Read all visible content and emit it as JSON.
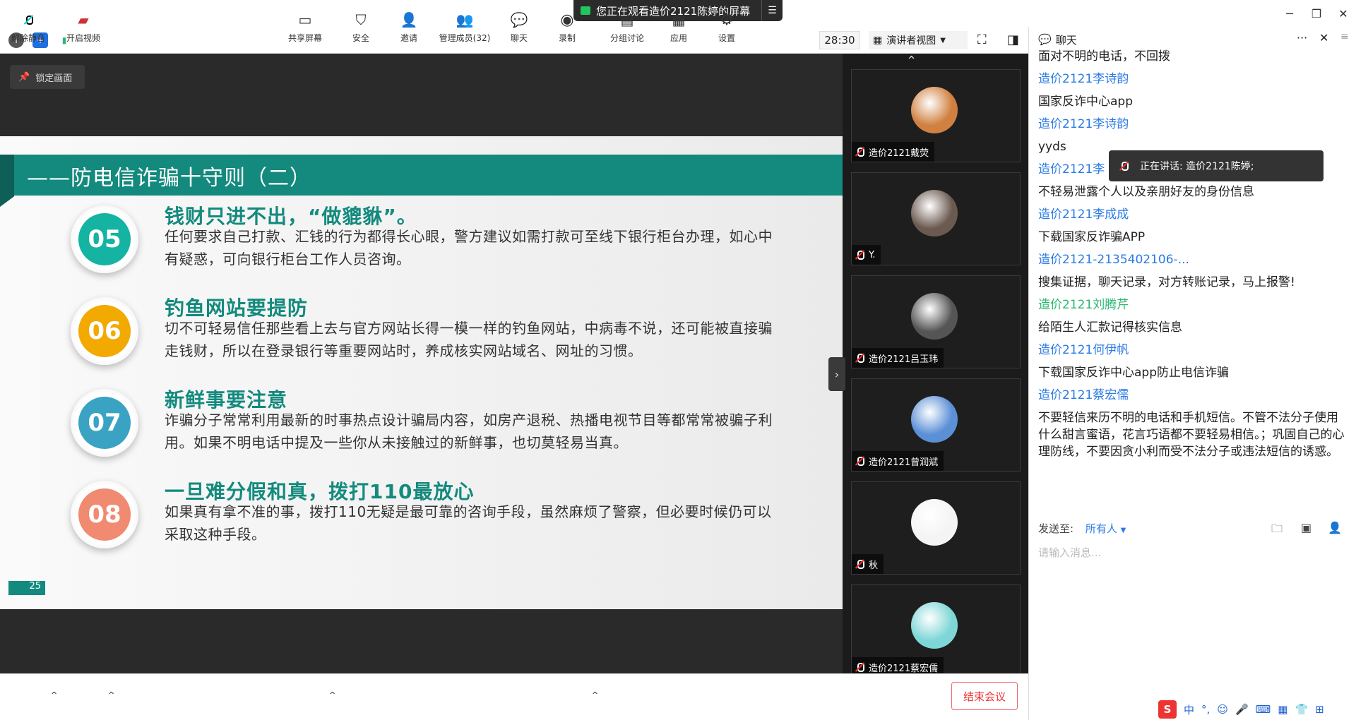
{
  "share_banner": {
    "text": "您正在观看造价2121陈婷的屏幕"
  },
  "toolbar": {
    "timer": "28:30",
    "view_label": "演讲者视图"
  },
  "video": {
    "lock_label": "锁定画面"
  },
  "slide": {
    "title": "——防电信诈骗十守则（二）",
    "page": "25",
    "rules": [
      {
        "num": "05",
        "color": "#14b3a2",
        "head": "钱财只进不出，“做貔貅”。",
        "body": "任何要求自己打款、汇钱的行为都得长心眼，警方建议如需打款可至线下银行柜台办理，如心中有疑惑，可向银行柜台工作人员咨询。"
      },
      {
        "num": "06",
        "color": "#f2a900",
        "head": "钓鱼网站要提防",
        "body": "切不可轻易信任那些看上去与官方网站长得一模一样的钓鱼网站，中病毒不说，还可能被直接骗走钱财，所以在登录银行等重要网站时，养成核实网站域名、网址的习惯。"
      },
      {
        "num": "07",
        "color": "#3aa3c4",
        "head": "新鲜事要注意",
        "body": "诈骗分子常常利用最新的时事热点设计骗局内容，如房产退税、热播电视节目等都常常被骗子利用。如果不明电话中提及一些你从未接触过的新鲜事，也切莫轻易当真。"
      },
      {
        "num": "08",
        "color": "#f08a70",
        "head": "一旦难分假和真，拨打110最放心",
        "body": "如果真有拿不准的事，拨打110无疑是最可靠的咨询手段，虽然麻烦了警察，但必要时候仍可以采取这种手段。"
      }
    ]
  },
  "participants": [
    {
      "name": "造价2121戴荧",
      "avatar_color": "#d08040"
    },
    {
      "name": "Y.",
      "avatar_color": "#6b5a50"
    },
    {
      "name": "造价2121吕玉玮",
      "avatar_color": "#555555"
    },
    {
      "name": "造价2121曾润斌",
      "avatar_color": "#5b8fd6"
    },
    {
      "name": "秋",
      "avatar_color": "#f4f4f4"
    },
    {
      "name": "造价2121蔡宏儒",
      "avatar_color": "#7fd6d6"
    }
  ],
  "bottom": {
    "unmute": "解除静音",
    "video": "开启视频",
    "share": "共享屏幕",
    "security": "安全",
    "invite": "邀请",
    "members": "管理成员(32)",
    "chat": "聊天",
    "record": "录制",
    "breakout": "分组讨论",
    "apps": "应用",
    "settings": "设置",
    "end": "结束会议"
  },
  "chat": {
    "title": "聊天",
    "speaking": "正在讲话: 造价2121陈婷;",
    "messages": [
      {
        "type": "text",
        "text": "面对不明的电话，不回拨"
      },
      {
        "type": "name",
        "text": "造价2121李诗韵"
      },
      {
        "type": "text",
        "text": "国家反诈中心app"
      },
      {
        "type": "name",
        "text": "造价2121李诗韵"
      },
      {
        "type": "text",
        "text": "yyds"
      },
      {
        "type": "name",
        "text": "造价2121李"
      },
      {
        "type": "text",
        "text": "不轻易泄露个人以及亲朋好友的身份信息"
      },
      {
        "type": "name",
        "text": "造价2121李成成"
      },
      {
        "type": "text",
        "text": "下载国家反诈骗APP"
      },
      {
        "type": "name",
        "text": "造价2121-2135402106-..."
      },
      {
        "type": "text",
        "text": "搜集证据，聊天记录，对方转账记录，马上报警!"
      },
      {
        "type": "name-green",
        "text": "造价2121刘腾芹"
      },
      {
        "type": "text",
        "text": "给陌生人汇款记得核实信息"
      },
      {
        "type": "name",
        "text": "造价2121何伊帆"
      },
      {
        "type": "text",
        "text": "下载国家反诈中心app防止电信诈骗"
      },
      {
        "type": "name",
        "text": "造价2121蔡宏儒"
      },
      {
        "type": "text",
        "text": "不要轻信来历不明的电话和手机短信。不管不法分子使用什么甜言蜜语，花言巧语都不要轻易相信。；巩固自己的心理防线，不要因贪小利而受不法分子或违法短信的诱惑。"
      }
    ],
    "send_to_label": "发送至:",
    "send_to_value": "所有人",
    "input_placeholder": "请输入消息..."
  },
  "ime": {
    "lang": "中"
  }
}
